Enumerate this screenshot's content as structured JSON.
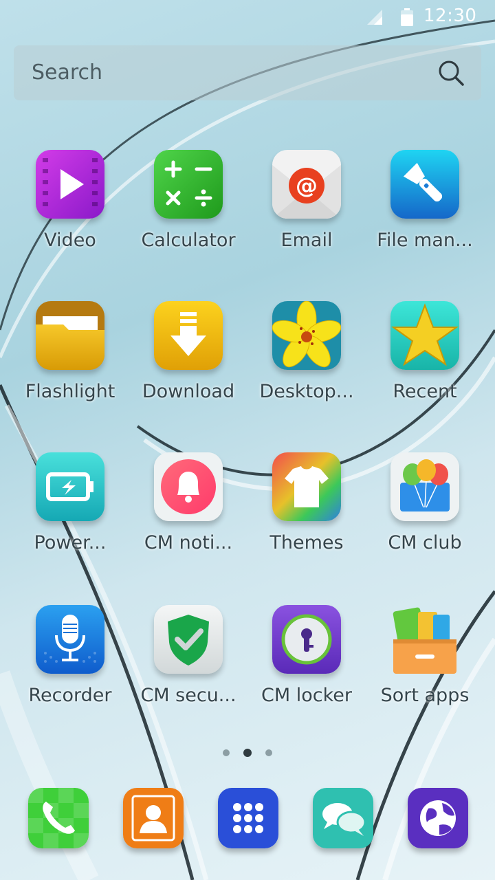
{
  "status_bar": {
    "time": "12:30"
  },
  "search": {
    "placeholder": "Search"
  },
  "apps": [
    {
      "label": "Video"
    },
    {
      "label": "Calculator"
    },
    {
      "label": "Email"
    },
    {
      "label": "File man..."
    },
    {
      "label": "Flashlight"
    },
    {
      "label": "Download"
    },
    {
      "label": "Desktop..."
    },
    {
      "label": "Recent"
    },
    {
      "label": "Power..."
    },
    {
      "label": "CM noti..."
    },
    {
      "label": "Themes"
    },
    {
      "label": "CM club"
    },
    {
      "label": "Recorder"
    },
    {
      "label": "CM secu..."
    },
    {
      "label": "CM locker"
    },
    {
      "label": "Sort apps"
    }
  ],
  "pager": {
    "count": 3,
    "active_index": 1
  },
  "dock": [
    {
      "icon": "phone-icon"
    },
    {
      "icon": "contacts-icon"
    },
    {
      "icon": "app-drawer-icon"
    },
    {
      "icon": "messages-icon"
    },
    {
      "icon": "browser-icon"
    }
  ]
}
